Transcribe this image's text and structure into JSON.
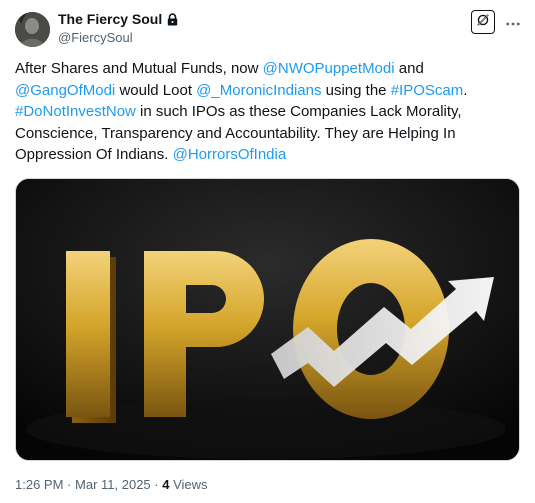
{
  "author": {
    "display_name": "The Fiercy Soul",
    "handle": "@FiercySoul",
    "protected_icon": "lock-icon",
    "avatar_icon": "avatar-image"
  },
  "actions": {
    "grok_icon": "grok-icon",
    "more_icon": "more-dots-icon"
  },
  "tweet": {
    "segments": [
      {
        "text": "After Shares and Mutual Funds, now ",
        "link": false
      },
      {
        "text": "@NWOPuppetModi",
        "link": true
      },
      {
        "text": " and ",
        "link": false
      },
      {
        "text": "@GangOfModi",
        "link": true
      },
      {
        "text": " would Loot ",
        "link": false
      },
      {
        "text": "@_MoronicIndians",
        "link": true
      },
      {
        "text": " using the ",
        "link": false
      },
      {
        "text": "#IPOScam",
        "link": true
      },
      {
        "text": ". ",
        "link": false
      },
      {
        "text": "#DoNotInvestNow",
        "link": true
      },
      {
        "text": " in such IPOs as these Companies Lack Morality, Conscience, Transparency and Accountability. They are Helping In Oppression Of Indians. ",
        "link": false
      },
      {
        "text": "@HorrorsOfIndia",
        "link": true
      }
    ]
  },
  "media": {
    "image_text": "IPO",
    "description_icon": "ipo-rising-arrow-image"
  },
  "meta": {
    "time": "1:26 PM",
    "date": "Mar 11, 2025",
    "views_count": "4",
    "views_label": "Views",
    "separator": "·"
  },
  "colors": {
    "link": "#1d9bf0",
    "text": "#0f1419",
    "muted": "#536471",
    "gold": "#d4a52a"
  }
}
